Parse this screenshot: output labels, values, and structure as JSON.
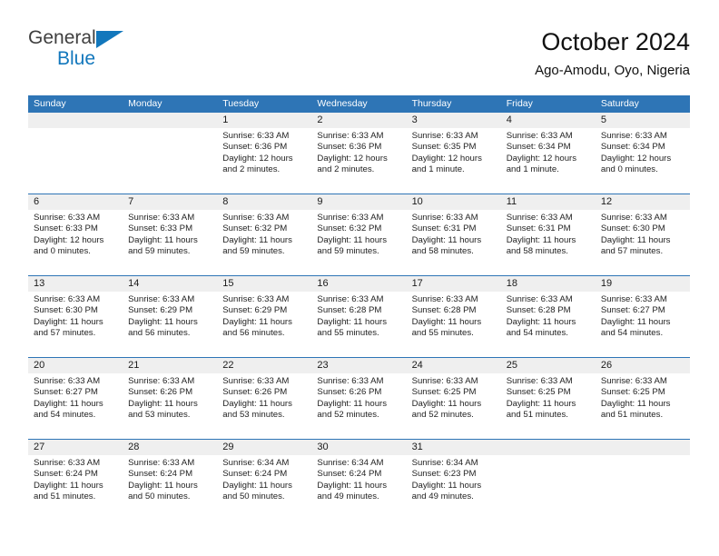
{
  "brand": {
    "name_part1": "General",
    "name_part2": "Blue",
    "triangle_color": "#1277bc"
  },
  "header": {
    "title": "October 2024",
    "subtitle": "Ago-Amodu, Oyo, Nigeria"
  },
  "theme": {
    "header_blue": "#2e75b6",
    "daynum_band": "#efefef",
    "text": "#232323"
  },
  "calendar": {
    "weekday_headers": [
      "Sunday",
      "Monday",
      "Tuesday",
      "Wednesday",
      "Thursday",
      "Friday",
      "Saturday"
    ],
    "weeks": [
      [
        {
          "day": "",
          "sunrise": "",
          "sunset": "",
          "daylight_line1": "",
          "daylight_line2": ""
        },
        {
          "day": "",
          "sunrise": "",
          "sunset": "",
          "daylight_line1": "",
          "daylight_line2": ""
        },
        {
          "day": "1",
          "sunrise": "Sunrise: 6:33 AM",
          "sunset": "Sunset: 6:36 PM",
          "daylight_line1": "Daylight: 12 hours",
          "daylight_line2": "and 2 minutes."
        },
        {
          "day": "2",
          "sunrise": "Sunrise: 6:33 AM",
          "sunset": "Sunset: 6:36 PM",
          "daylight_line1": "Daylight: 12 hours",
          "daylight_line2": "and 2 minutes."
        },
        {
          "day": "3",
          "sunrise": "Sunrise: 6:33 AM",
          "sunset": "Sunset: 6:35 PM",
          "daylight_line1": "Daylight: 12 hours",
          "daylight_line2": "and 1 minute."
        },
        {
          "day": "4",
          "sunrise": "Sunrise: 6:33 AM",
          "sunset": "Sunset: 6:34 PM",
          "daylight_line1": "Daylight: 12 hours",
          "daylight_line2": "and 1 minute."
        },
        {
          "day": "5",
          "sunrise": "Sunrise: 6:33 AM",
          "sunset": "Sunset: 6:34 PM",
          "daylight_line1": "Daylight: 12 hours",
          "daylight_line2": "and 0 minutes."
        }
      ],
      [
        {
          "day": "6",
          "sunrise": "Sunrise: 6:33 AM",
          "sunset": "Sunset: 6:33 PM",
          "daylight_line1": "Daylight: 12 hours",
          "daylight_line2": "and 0 minutes."
        },
        {
          "day": "7",
          "sunrise": "Sunrise: 6:33 AM",
          "sunset": "Sunset: 6:33 PM",
          "daylight_line1": "Daylight: 11 hours",
          "daylight_line2": "and 59 minutes."
        },
        {
          "day": "8",
          "sunrise": "Sunrise: 6:33 AM",
          "sunset": "Sunset: 6:32 PM",
          "daylight_line1": "Daylight: 11 hours",
          "daylight_line2": "and 59 minutes."
        },
        {
          "day": "9",
          "sunrise": "Sunrise: 6:33 AM",
          "sunset": "Sunset: 6:32 PM",
          "daylight_line1": "Daylight: 11 hours",
          "daylight_line2": "and 59 minutes."
        },
        {
          "day": "10",
          "sunrise": "Sunrise: 6:33 AM",
          "sunset": "Sunset: 6:31 PM",
          "daylight_line1": "Daylight: 11 hours",
          "daylight_line2": "and 58 minutes."
        },
        {
          "day": "11",
          "sunrise": "Sunrise: 6:33 AM",
          "sunset": "Sunset: 6:31 PM",
          "daylight_line1": "Daylight: 11 hours",
          "daylight_line2": "and 58 minutes."
        },
        {
          "day": "12",
          "sunrise": "Sunrise: 6:33 AM",
          "sunset": "Sunset: 6:30 PM",
          "daylight_line1": "Daylight: 11 hours",
          "daylight_line2": "and 57 minutes."
        }
      ],
      [
        {
          "day": "13",
          "sunrise": "Sunrise: 6:33 AM",
          "sunset": "Sunset: 6:30 PM",
          "daylight_line1": "Daylight: 11 hours",
          "daylight_line2": "and 57 minutes."
        },
        {
          "day": "14",
          "sunrise": "Sunrise: 6:33 AM",
          "sunset": "Sunset: 6:29 PM",
          "daylight_line1": "Daylight: 11 hours",
          "daylight_line2": "and 56 minutes."
        },
        {
          "day": "15",
          "sunrise": "Sunrise: 6:33 AM",
          "sunset": "Sunset: 6:29 PM",
          "daylight_line1": "Daylight: 11 hours",
          "daylight_line2": "and 56 minutes."
        },
        {
          "day": "16",
          "sunrise": "Sunrise: 6:33 AM",
          "sunset": "Sunset: 6:28 PM",
          "daylight_line1": "Daylight: 11 hours",
          "daylight_line2": "and 55 minutes."
        },
        {
          "day": "17",
          "sunrise": "Sunrise: 6:33 AM",
          "sunset": "Sunset: 6:28 PM",
          "daylight_line1": "Daylight: 11 hours",
          "daylight_line2": "and 55 minutes."
        },
        {
          "day": "18",
          "sunrise": "Sunrise: 6:33 AM",
          "sunset": "Sunset: 6:28 PM",
          "daylight_line1": "Daylight: 11 hours",
          "daylight_line2": "and 54 minutes."
        },
        {
          "day": "19",
          "sunrise": "Sunrise: 6:33 AM",
          "sunset": "Sunset: 6:27 PM",
          "daylight_line1": "Daylight: 11 hours",
          "daylight_line2": "and 54 minutes."
        }
      ],
      [
        {
          "day": "20",
          "sunrise": "Sunrise: 6:33 AM",
          "sunset": "Sunset: 6:27 PM",
          "daylight_line1": "Daylight: 11 hours",
          "daylight_line2": "and 54 minutes."
        },
        {
          "day": "21",
          "sunrise": "Sunrise: 6:33 AM",
          "sunset": "Sunset: 6:26 PM",
          "daylight_line1": "Daylight: 11 hours",
          "daylight_line2": "and 53 minutes."
        },
        {
          "day": "22",
          "sunrise": "Sunrise: 6:33 AM",
          "sunset": "Sunset: 6:26 PM",
          "daylight_line1": "Daylight: 11 hours",
          "daylight_line2": "and 53 minutes."
        },
        {
          "day": "23",
          "sunrise": "Sunrise: 6:33 AM",
          "sunset": "Sunset: 6:26 PM",
          "daylight_line1": "Daylight: 11 hours",
          "daylight_line2": "and 52 minutes."
        },
        {
          "day": "24",
          "sunrise": "Sunrise: 6:33 AM",
          "sunset": "Sunset: 6:25 PM",
          "daylight_line1": "Daylight: 11 hours",
          "daylight_line2": "and 52 minutes."
        },
        {
          "day": "25",
          "sunrise": "Sunrise: 6:33 AM",
          "sunset": "Sunset: 6:25 PM",
          "daylight_line1": "Daylight: 11 hours",
          "daylight_line2": "and 51 minutes."
        },
        {
          "day": "26",
          "sunrise": "Sunrise: 6:33 AM",
          "sunset": "Sunset: 6:25 PM",
          "daylight_line1": "Daylight: 11 hours",
          "daylight_line2": "and 51 minutes."
        }
      ],
      [
        {
          "day": "27",
          "sunrise": "Sunrise: 6:33 AM",
          "sunset": "Sunset: 6:24 PM",
          "daylight_line1": "Daylight: 11 hours",
          "daylight_line2": "and 51 minutes."
        },
        {
          "day": "28",
          "sunrise": "Sunrise: 6:33 AM",
          "sunset": "Sunset: 6:24 PM",
          "daylight_line1": "Daylight: 11 hours",
          "daylight_line2": "and 50 minutes."
        },
        {
          "day": "29",
          "sunrise": "Sunrise: 6:34 AM",
          "sunset": "Sunset: 6:24 PM",
          "daylight_line1": "Daylight: 11 hours",
          "daylight_line2": "and 50 minutes."
        },
        {
          "day": "30",
          "sunrise": "Sunrise: 6:34 AM",
          "sunset": "Sunset: 6:24 PM",
          "daylight_line1": "Daylight: 11 hours",
          "daylight_line2": "and 49 minutes."
        },
        {
          "day": "31",
          "sunrise": "Sunrise: 6:34 AM",
          "sunset": "Sunset: 6:23 PM",
          "daylight_line1": "Daylight: 11 hours",
          "daylight_line2": "and 49 minutes."
        },
        {
          "day": "",
          "sunrise": "",
          "sunset": "",
          "daylight_line1": "",
          "daylight_line2": ""
        },
        {
          "day": "",
          "sunrise": "",
          "sunset": "",
          "daylight_line1": "",
          "daylight_line2": ""
        }
      ]
    ]
  }
}
